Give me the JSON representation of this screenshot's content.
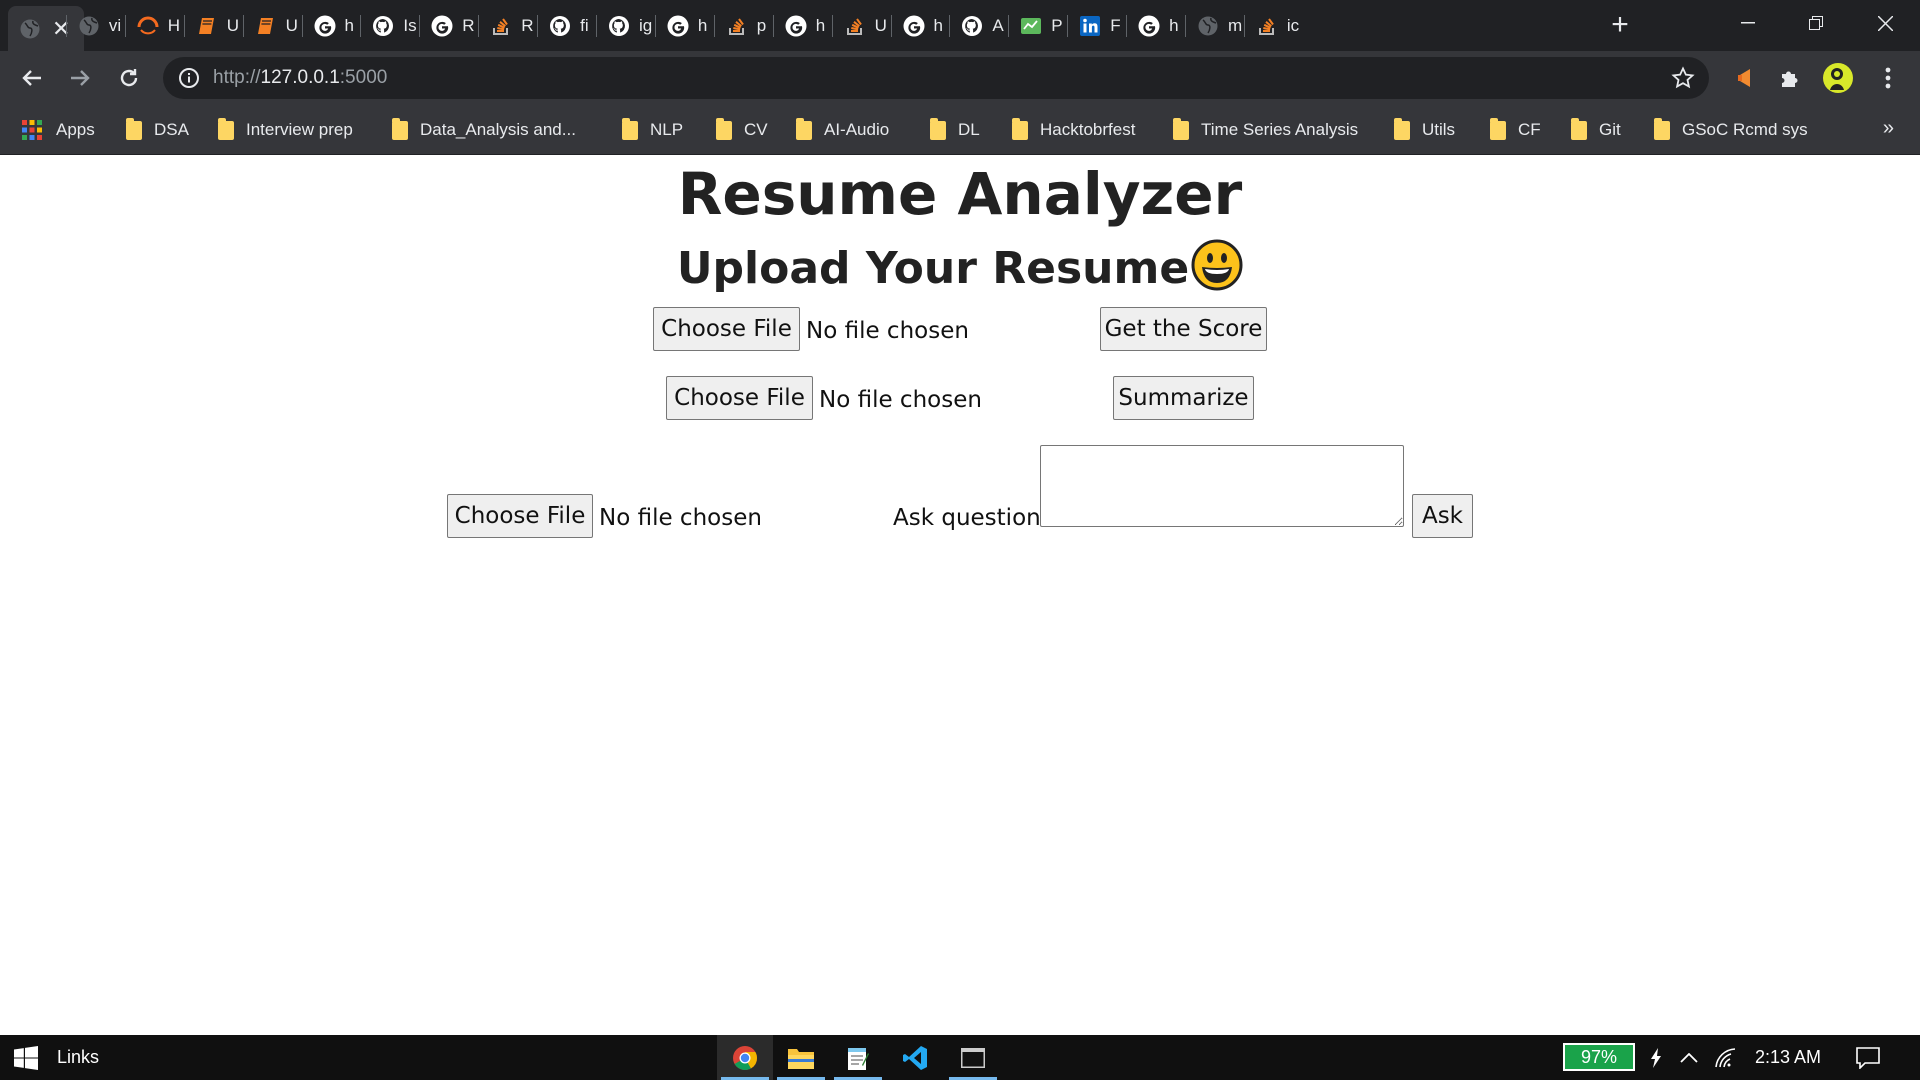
{
  "browser": {
    "tabs": [
      {
        "title": "",
        "icon": "globe-icon",
        "active": true
      },
      {
        "title": "vi",
        "icon": "globe-icon"
      },
      {
        "title": "H",
        "icon": "orange-arc-icon"
      },
      {
        "title": "U",
        "icon": "orange-book-icon"
      },
      {
        "title": "U",
        "icon": "orange-book-icon"
      },
      {
        "title": "h",
        "icon": "google-icon"
      },
      {
        "title": "Is",
        "icon": "github-icon"
      },
      {
        "title": "R",
        "icon": "google-icon"
      },
      {
        "title": "R",
        "icon": "stackoverflow-icon"
      },
      {
        "title": "fi",
        "icon": "github-icon"
      },
      {
        "title": "ig",
        "icon": "github-icon"
      },
      {
        "title": "h",
        "icon": "google-icon"
      },
      {
        "title": "p",
        "icon": "stackoverflow-icon"
      },
      {
        "title": "h",
        "icon": "google-icon"
      },
      {
        "title": "U",
        "icon": "stackoverflow-icon"
      },
      {
        "title": "h",
        "icon": "google-icon"
      },
      {
        "title": "A",
        "icon": "github-icon"
      },
      {
        "title": "P",
        "icon": "green-chart-icon"
      },
      {
        "title": "F",
        "icon": "linkedin-icon"
      },
      {
        "title": "h",
        "icon": "google-icon"
      },
      {
        "title": "m",
        "icon": "globe-icon"
      },
      {
        "title": "ic",
        "icon": "stackoverflow-icon"
      }
    ],
    "url_scheme": "http://",
    "url_host": "127.0.0.1",
    "url_port": ":5000",
    "bookmarks": [
      "Apps",
      "DSA",
      "Interview prep",
      "Data_Analysis and...",
      "NLP",
      "CV",
      "AI-Audio",
      "DL",
      "Hacktobrfest",
      "Time Series Analysis",
      "Utils",
      "CF",
      "Git",
      "GSoC Rcmd sys"
    ],
    "more_bookmarks": "»"
  },
  "page": {
    "title": "Resume Analyzer",
    "upload_heading": "Upload Your Resume",
    "choose_file_label": "Choose File",
    "no_file_text": "No file chosen",
    "get_score_label": "Get the Score",
    "summarize_label": "Summarize",
    "ask_question_label": "Ask question:",
    "ask_label": "Ask",
    "question_value": ""
  },
  "taskbar": {
    "links_label": "Links",
    "battery": "97%",
    "time": "2:13 AM"
  },
  "colors": {
    "tabstrip_bg": "#202124",
    "toolbar_bg": "#35363a",
    "folder": "#fdd663",
    "battery": "#1aa34a",
    "taskbar_bg": "#101010"
  }
}
